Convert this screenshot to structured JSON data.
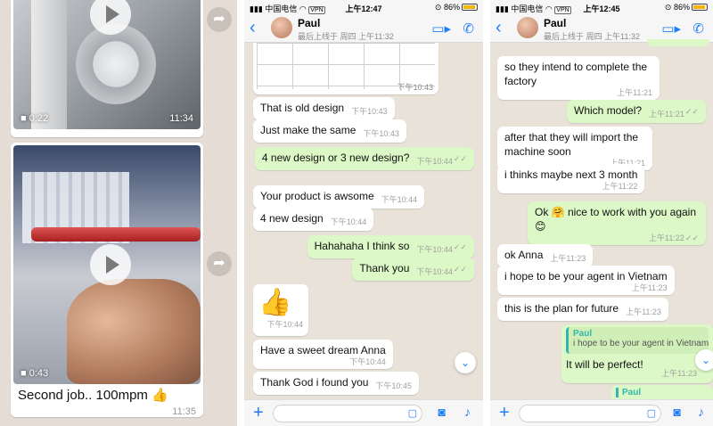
{
  "panel1": {
    "videos": [
      {
        "duration": "0:22",
        "time": "11:34"
      },
      {
        "duration": "0:43",
        "time": "11:35"
      }
    ],
    "caption": "Second job..  100mpm 👍",
    "icons": {
      "play": "play-icon",
      "forward": "forward-icon",
      "video": "video-camera-icon"
    }
  },
  "panel2": {
    "status": {
      "carrier": "中国电信",
      "vpn": "VPN",
      "time": "上午12:47",
      "battery": "86%"
    },
    "contact": {
      "name": "Paul",
      "last_seen": "最后上线于 周四 上午11:32"
    },
    "image_time": "下午10:43",
    "messages": [
      {
        "dir": "in",
        "text": "That is old design",
        "time": "下午10:43"
      },
      {
        "dir": "in",
        "text": "Just make the same",
        "time": "下午10:43"
      },
      {
        "dir": "out",
        "text": "4 new design or 3 new design?",
        "time": "下午10:44"
      },
      {
        "dir": "in",
        "text": "Your product is awsome",
        "time": "下午10:44"
      },
      {
        "dir": "in",
        "text": "4 new design",
        "time": "下午10:44"
      },
      {
        "dir": "out",
        "text": "Hahahaha I think so",
        "time": "下午10:44"
      },
      {
        "dir": "out",
        "text": "Thank you",
        "time": "下午10:44"
      },
      {
        "dir": "in",
        "text": "👍",
        "time": "下午10:44"
      },
      {
        "dir": "in",
        "text": "Have a sweet dream Anna",
        "time": "下午10:44"
      },
      {
        "dir": "in",
        "text": "Thank God i found you",
        "time": "下午10:45"
      }
    ]
  },
  "panel3": {
    "status": {
      "carrier": "中国电信",
      "vpn": "VPN",
      "time": "上午12:45",
      "battery": "86%"
    },
    "contact": {
      "name": "Paul",
      "last_seen": "最后上线于 周四 上午11:32"
    },
    "messages": [
      {
        "dir": "in",
        "text": "so they intend to complete the factory",
        "time": "上午11:21"
      },
      {
        "dir": "out",
        "text": "Which model?",
        "time": "上午11:21"
      },
      {
        "dir": "in",
        "text": "after that they will import the machine soon",
        "time": "上午11:21"
      },
      {
        "dir": "in",
        "text": "i thinks maybe next 3 month",
        "time": "上午11:22"
      },
      {
        "dir": "out",
        "text": "Ok 🤗 nice to work with you again 😊",
        "time": "上午11:22"
      },
      {
        "dir": "in",
        "text": "ok Anna",
        "time": "上午11:23"
      },
      {
        "dir": "in",
        "text": "i hope to be your agent in Vietnam",
        "time": "上午11:23"
      },
      {
        "dir": "in",
        "text": "this is the plan for future",
        "time": "上午11:23"
      }
    ],
    "reply": {
      "quote_name": "Paul",
      "quote_text": "i hope to be your agent in Vietnam",
      "text": "It will be perfect!",
      "time": "上午11:23"
    },
    "reply2_name": "Paul"
  },
  "colors": {
    "accent": "#1f7ef7",
    "outgoing": "#dcf8c6",
    "incoming": "#ffffff",
    "quote_bar": "#35b5ae"
  }
}
